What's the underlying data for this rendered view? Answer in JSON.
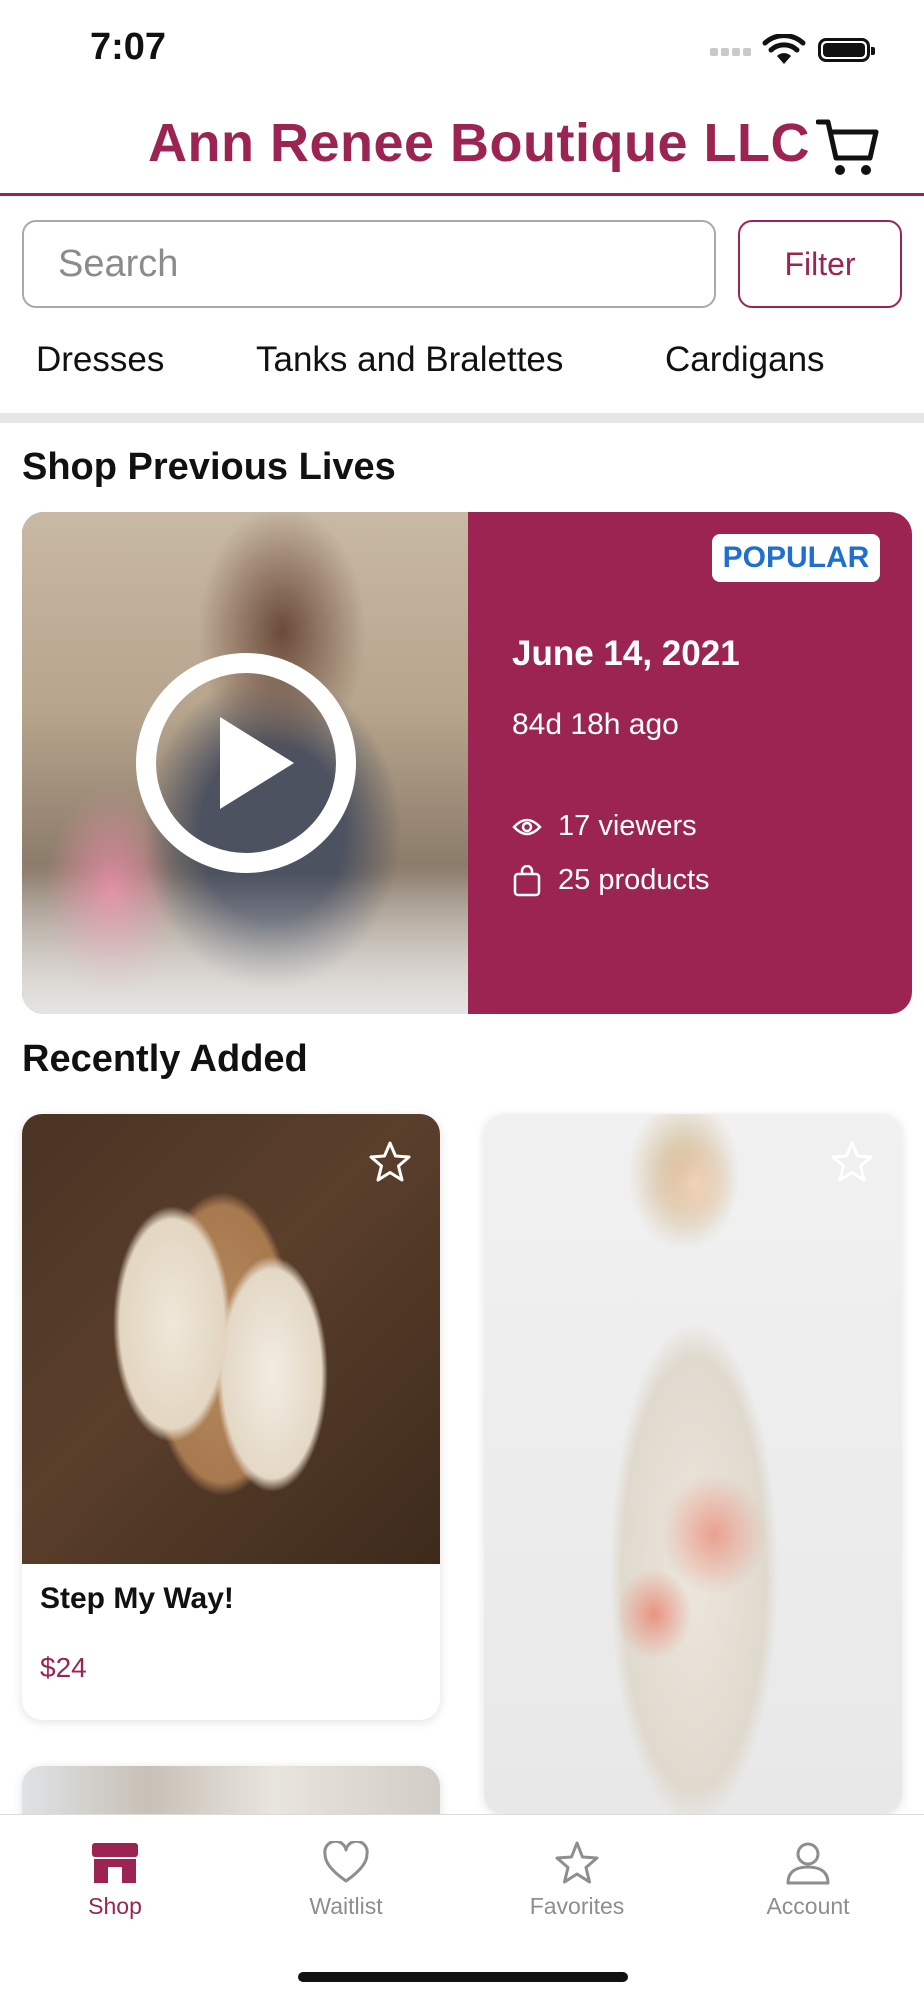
{
  "status_bar": {
    "time": "7:07"
  },
  "header": {
    "title": "Ann Renee Boutique LLC"
  },
  "search": {
    "placeholder": "Search",
    "filter_label": "Filter"
  },
  "categories": [
    "Dresses",
    "Tanks and Bralettes",
    "Cardigans"
  ],
  "sections": {
    "previous_lives": "Shop Previous Lives",
    "recently_added": "Recently Added"
  },
  "live": {
    "badge": "POPULAR",
    "date": "June 14, 2021",
    "ago": "84d 18h ago",
    "viewers": "17 viewers",
    "products": "25 products"
  },
  "products": [
    {
      "title": "Step My Way!",
      "price": "$24"
    }
  ],
  "tabs": [
    {
      "label": "Shop",
      "icon": "store-icon",
      "active": true
    },
    {
      "label": "Waitlist",
      "icon": "heart-icon",
      "active": false
    },
    {
      "label": "Favorites",
      "icon": "star-icon",
      "active": false
    },
    {
      "label": "Account",
      "icon": "person-icon",
      "active": false
    }
  ],
  "colors": {
    "brand": "#9c2452",
    "badge_text": "#1f6fd1",
    "inactive_tab": "#8e8e8e"
  }
}
